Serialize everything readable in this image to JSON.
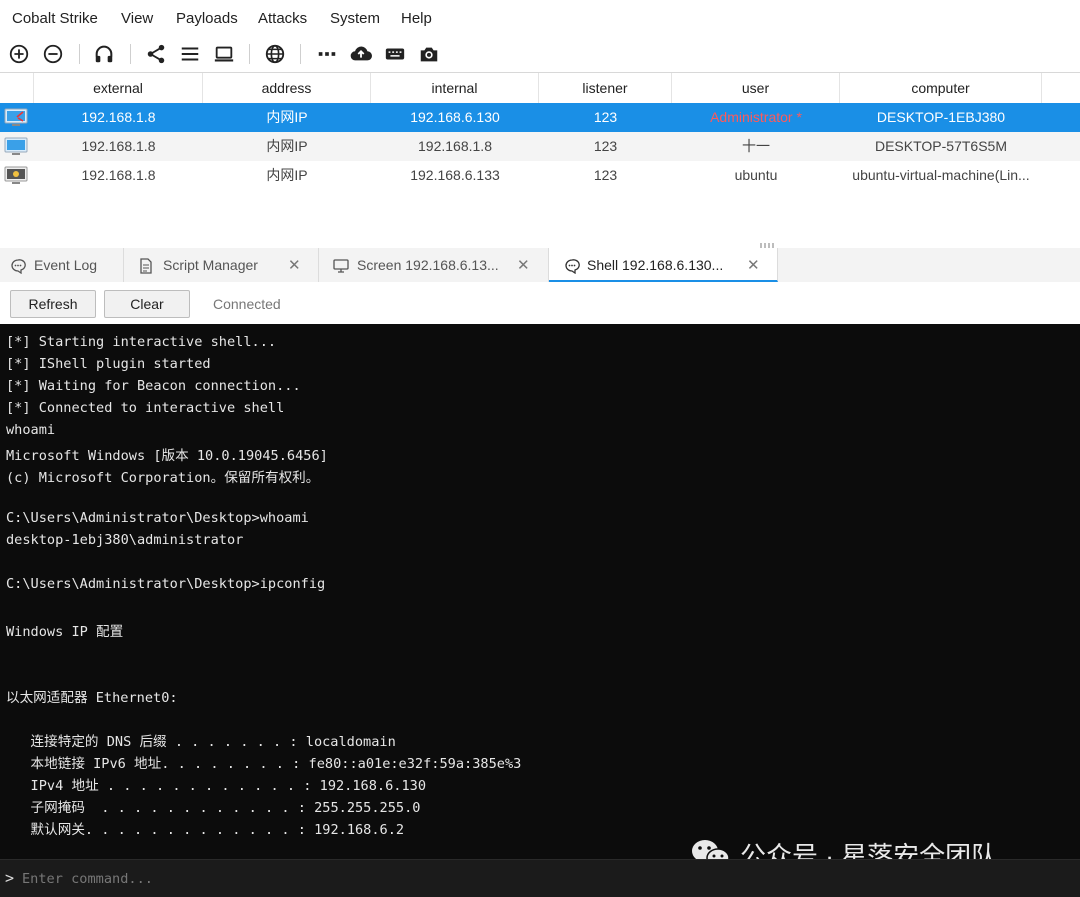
{
  "menu": [
    "Cobalt Strike",
    "View",
    "Payloads",
    "Attacks",
    "System",
    "Help"
  ],
  "toolbar": {
    "icons": [
      "add-circle-icon",
      "remove-circle-icon",
      "headphones-icon",
      "share-icon",
      "list-icon",
      "laptop-icon",
      "globe-icon",
      "dots-icon",
      "cloud-upload-icon",
      "keyboard-icon",
      "camera-icon"
    ]
  },
  "table": {
    "columns": [
      "external",
      "address",
      "internal",
      "listener",
      "user",
      "computer"
    ],
    "rows": [
      {
        "icon": "windows-beacon-icon",
        "external": "192.168.1.8",
        "address": "内网IP",
        "internal": "192.168.6.130",
        "listener": "123",
        "user": "Administrator *",
        "computer": "DESKTOP-1EBJ380"
      },
      {
        "icon": "windows-beacon-icon",
        "external": "192.168.1.8",
        "address": "内网IP",
        "internal": "192.168.1.8",
        "listener": "123",
        "user": "十一",
        "computer": "DESKTOP-57T6S5M"
      },
      {
        "icon": "linux-beacon-icon",
        "external": "192.168.1.8",
        "address": "内网IP",
        "internal": "192.168.6.133",
        "listener": "123",
        "user": "ubuntu",
        "computer": "ubuntu-virtual-machine(Lin..."
      }
    ]
  },
  "tabs": [
    {
      "label": "Event Log",
      "icon": "chat-icon",
      "closable": false
    },
    {
      "label": "Script Manager",
      "icon": "document-icon",
      "closable": true
    },
    {
      "label": "Screen 192.168.6.13...",
      "icon": "monitor-icon",
      "closable": true
    },
    {
      "label": "Shell 192.168.6.130...",
      "icon": "chat-icon",
      "closable": true,
      "active": true
    }
  ],
  "controls": {
    "refresh": "Refresh",
    "clear": "Clear",
    "status": "Connected"
  },
  "terminal": {
    "lines": [
      "[*] Starting interactive shell...",
      "[*] IShell plugin started",
      "[*] Waiting for Beacon connection...",
      "[*] Connected to interactive shell",
      "whoami",
      "Microsoft Windows [版本 10.0.19045.6456]",
      "(c) Microsoft Corporation。保留所有权利。",
      "",
      "C:\\Users\\Administrator\\Desktop>whoami",
      "desktop-1ebj380\\administrator",
      "",
      "C:\\Users\\Administrator\\Desktop>ipconfig",
      "",
      "Windows IP 配置",
      "",
      "",
      "以太网适配器 Ethernet0:",
      "",
      "   连接特定的 DNS 后缀 . . . . . . . : localdomain",
      "   本地链接 IPv6 地址. . . . . . . . : fe80::a01e:e32f:59a:385e%3",
      "   IPv4 地址 . . . . . . . . . . . . : 192.168.6.130",
      "   子网掩码  . . . . . . . . . . . . : 255.255.255.0",
      "   默认网关. . . . . . . . . . . . . : 192.168.6.2"
    ]
  },
  "watermark": "公众号 · 星落安全团队",
  "command": {
    "prompt": ">",
    "placeholder": "Enter command..."
  },
  "colors": {
    "accent": "#1a8fe6",
    "admin_user": "#ff5a5a",
    "terminal_bg": "#0c0c0c"
  }
}
